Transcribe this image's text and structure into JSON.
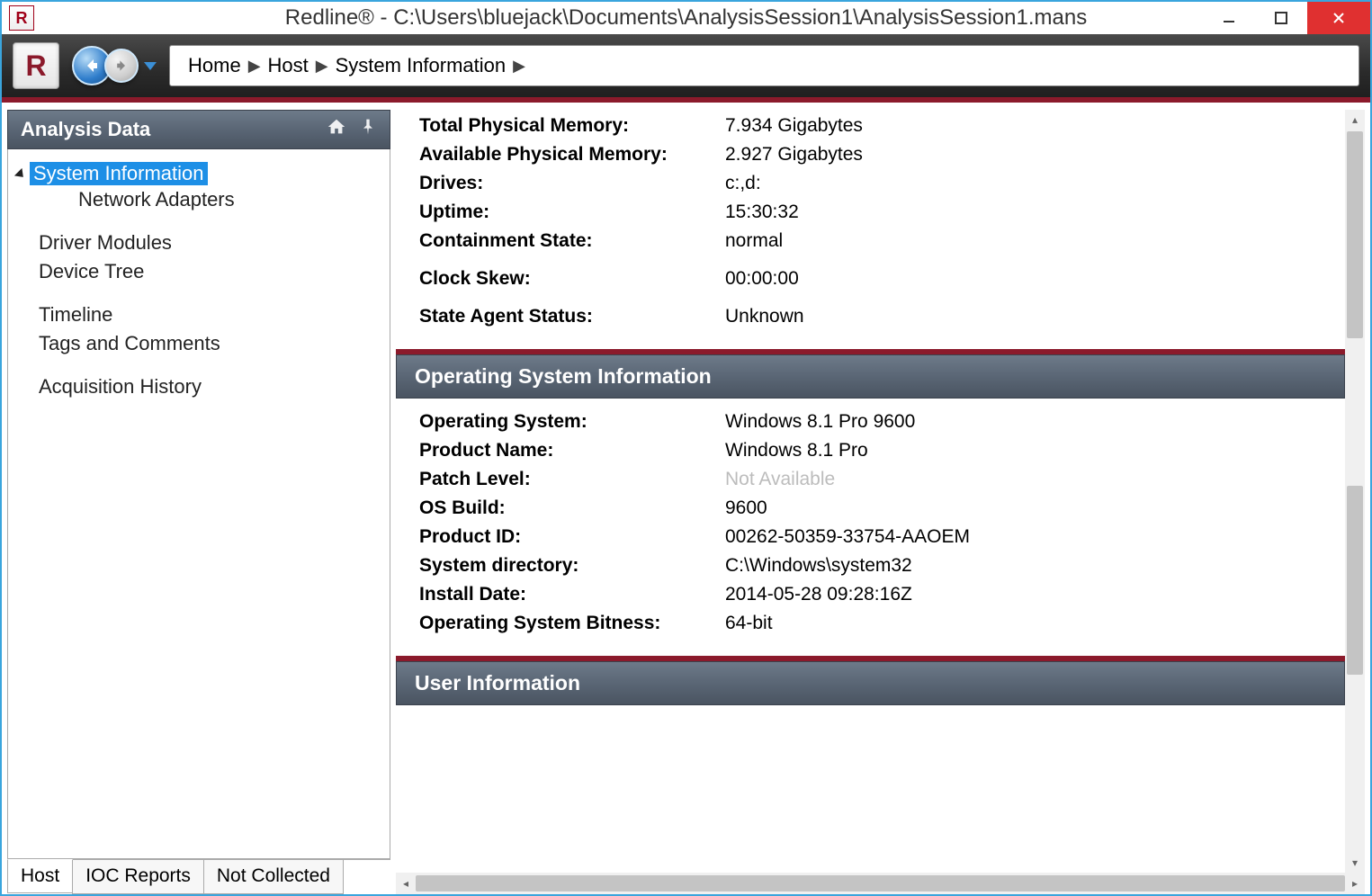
{
  "window": {
    "title": "Redline® - C:\\Users\\bluejack\\Documents\\AnalysisSession1\\AnalysisSession1.mans"
  },
  "breadcrumb": {
    "items": [
      "Home",
      "Host",
      "System Information"
    ]
  },
  "sidebar": {
    "title": "Analysis Data",
    "tree": {
      "sysinfo": "System Information",
      "netadapters": "Network Adapters",
      "drivermods": "Driver Modules",
      "devtree": "Device Tree",
      "timeline": "Timeline",
      "tags": "Tags and Comments",
      "acq": "Acquisition History"
    }
  },
  "bottom_tabs": {
    "host": "Host",
    "ioc": "IOC Reports",
    "notcollected": "Not Collected"
  },
  "top_kv": {
    "total_phys_mem_k": "Total Physical Memory:",
    "total_phys_mem_v": "7.934 Gigabytes",
    "avail_phys_mem_k": "Available Physical Memory:",
    "avail_phys_mem_v": "2.927 Gigabytes",
    "drives_k": "Drives:",
    "drives_v": "c:,d:",
    "uptime_k": "Uptime:",
    "uptime_v": "15:30:32",
    "containment_k": "Containment State:",
    "containment_v": "normal",
    "clockskew_k": "Clock Skew:",
    "clockskew_v": "00:00:00",
    "agentstatus_k": "State Agent Status:",
    "agentstatus_v": "Unknown"
  },
  "os_section": {
    "header": "Operating System Information",
    "os_k": "Operating System:",
    "os_v": "Windows 8.1 Pro 9600",
    "prodname_k": "Product Name:",
    "prodname_v": "Windows 8.1 Pro",
    "patch_k": "Patch Level:",
    "patch_v": "Not Available",
    "build_k": "OS Build:",
    "build_v": "9600",
    "prodid_k": "Product ID:",
    "prodid_v": "00262-50359-33754-AAOEM",
    "sysdir_k": "System directory:",
    "sysdir_v": "C:\\Windows\\system32",
    "install_k": "Install Date:",
    "install_v": "2014-05-28 09:28:16Z",
    "bitness_k": "Operating System Bitness:",
    "bitness_v": "64-bit"
  },
  "user_section": {
    "header": "User Information"
  }
}
